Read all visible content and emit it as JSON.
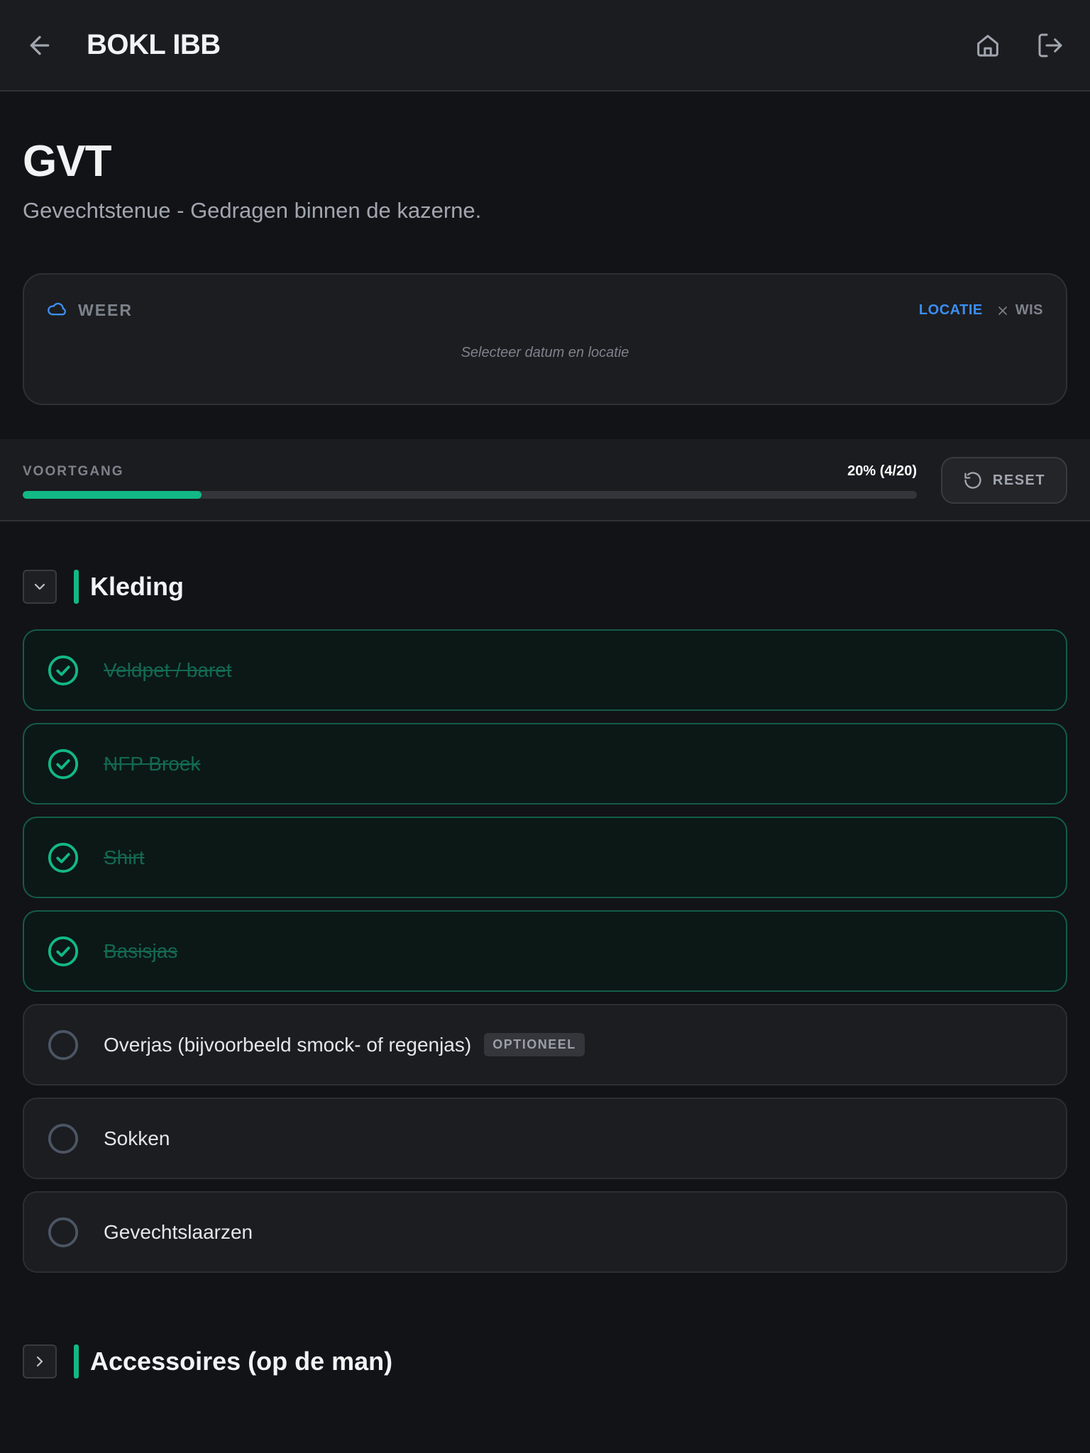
{
  "header": {
    "title": "BOKL IBB",
    "back_icon": "arrow-left-icon",
    "home_icon": "home-icon",
    "logout_icon": "logout-icon"
  },
  "page": {
    "title": "GVT",
    "subtitle": "Gevechtstenue - Gedragen binnen de kazerne."
  },
  "weather": {
    "label": "WEER",
    "location_link": "LOCATIE",
    "clear_label": "WIS",
    "hint": "Selecteer datum en locatie"
  },
  "progress": {
    "label": "VOORTGANG",
    "value_text": "20% (4/20)",
    "fraction": 0.2,
    "reset_label": "RESET"
  },
  "sections": [
    {
      "title": "Kleding",
      "expanded": true,
      "items": [
        {
          "label": "Veldpet / baret",
          "done": true
        },
        {
          "label": "NFP Broek",
          "done": true
        },
        {
          "label": "Shirt",
          "done": true
        },
        {
          "label": "Basisjas",
          "done": true
        },
        {
          "label": "Overjas (bijvoorbeeld smock- of regenjas)",
          "done": false,
          "badge": "OPTIONEEL"
        },
        {
          "label": "Sokken",
          "done": false
        },
        {
          "label": "Gevechtslaarzen",
          "done": false
        }
      ]
    },
    {
      "title": "Accessoires (op de man)",
      "expanded": false,
      "items": []
    }
  ],
  "colors": {
    "accent": "#12b886",
    "link": "#3b8ff5",
    "background": "#121316"
  }
}
